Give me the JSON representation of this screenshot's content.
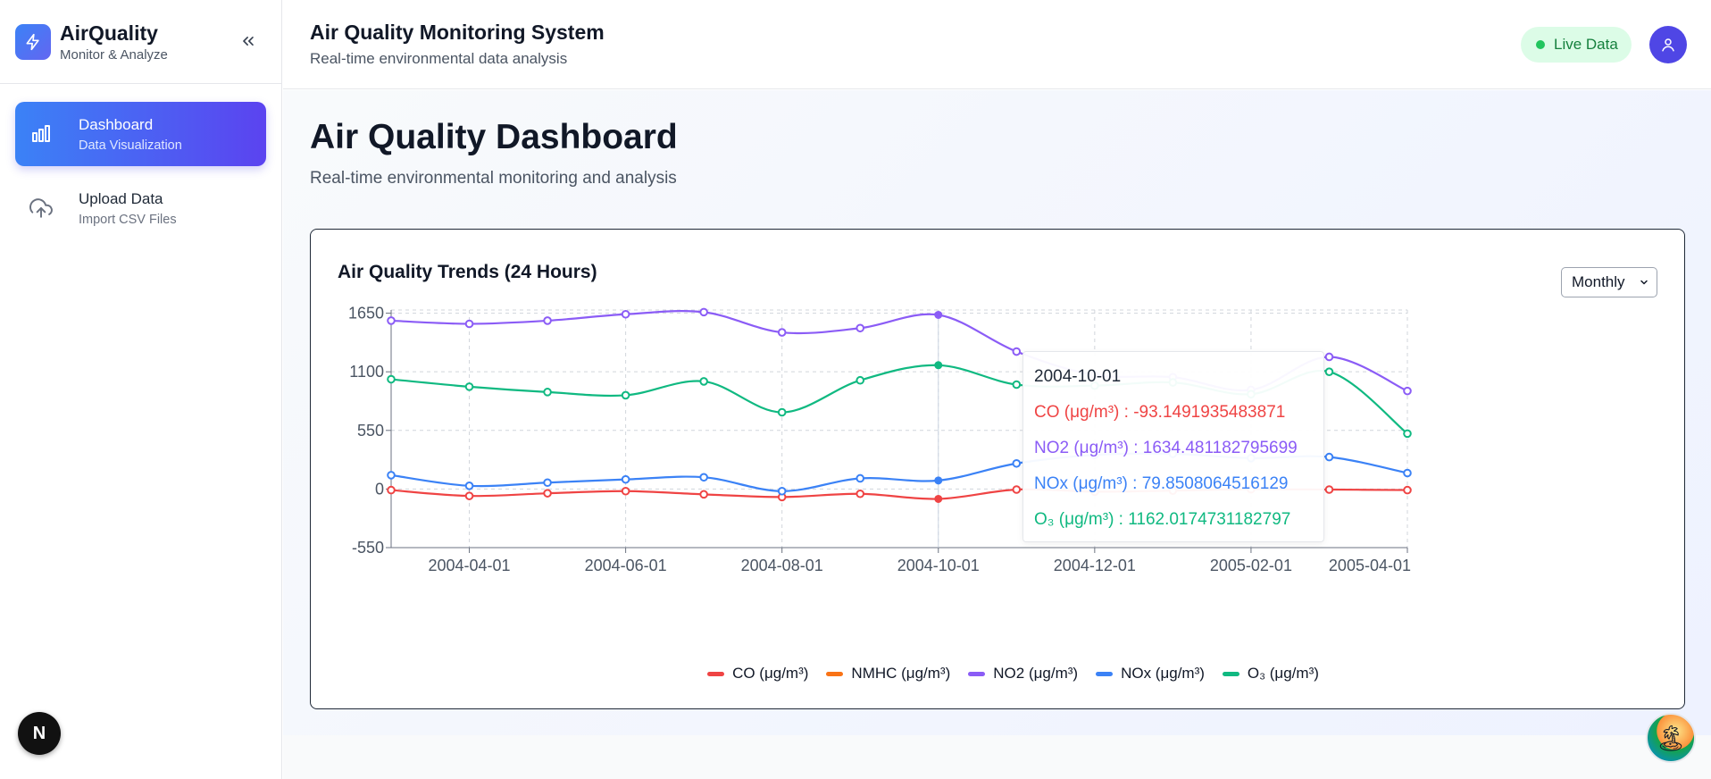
{
  "brand": {
    "title": "AirQuality",
    "subtitle": "Monitor & Analyze"
  },
  "nav": [
    {
      "label": "Dashboard",
      "sub": "Data Visualization",
      "icon": "bar-chart-icon",
      "active": true
    },
    {
      "label": "Upload Data",
      "sub": "Import CSV Files",
      "icon": "cloud-upload-icon",
      "active": false
    }
  ],
  "header": {
    "title": "Air Quality Monitoring System",
    "subtitle": "Real-time environmental data analysis",
    "live_label": "Live Data"
  },
  "page": {
    "title": "Air Quality Dashboard",
    "subtitle": "Real-time environmental monitoring and analysis"
  },
  "card": {
    "title": "Air Quality Trends (24 Hours)",
    "period": "Monthly",
    "period_options": [
      "Monthly"
    ]
  },
  "tooltip": {
    "date": "2004-10-01",
    "rows": [
      {
        "label": "CO (μg/m³) : -93.1491935483871",
        "color": "#ef4444"
      },
      {
        "label": "NO2 (μg/m³) : 1634.481182795699",
        "color": "#8b5cf6"
      },
      {
        "label": "NOx (μg/m³) : 79.8508064516129",
        "color": "#3b82f6"
      },
      {
        "label": "O₃ (μg/m³) : 1162.0174731182797",
        "color": "#10b981"
      }
    ]
  },
  "badge_letter": "N",
  "chart_data": {
    "type": "line",
    "x": [
      "2004-03-01",
      "2004-04-01",
      "2004-05-01",
      "2004-06-01",
      "2004-07-01",
      "2004-08-01",
      "2004-09-01",
      "2004-10-01",
      "2004-11-01",
      "2004-12-01",
      "2005-01-01",
      "2005-02-01",
      "2005-03-01",
      "2005-04-01"
    ],
    "xticks": [
      "2004-04-01",
      "2004-06-01",
      "2004-08-01",
      "2004-10-01",
      "2004-12-01",
      "2005-02-01",
      "2005-04-01"
    ],
    "yticks": [
      1650,
      1100,
      550,
      0,
      -550
    ],
    "ylim": [
      -550,
      1680
    ],
    "grid": true,
    "legend_position": "bottom",
    "highlight_x": "2004-10-01",
    "series": [
      {
        "name": "CO (μg/m³)",
        "color": "#ef4444",
        "values": [
          -10,
          -65,
          -40,
          -20,
          -50,
          -75,
          -45,
          -93,
          -5,
          -25,
          -15,
          -2,
          -5,
          -10
        ]
      },
      {
        "name": "NMHC (μg/m³)",
        "color": "#f97316",
        "values": []
      },
      {
        "name": "NO2 (μg/m³)",
        "color": "#8b5cf6",
        "values": [
          1580,
          1550,
          1580,
          1640,
          1660,
          1470,
          1510,
          1634,
          1290,
          1070,
          1050,
          930,
          1240,
          920
        ]
      },
      {
        "name": "NOx (μg/m³)",
        "color": "#3b82f6",
        "values": [
          130,
          30,
          60,
          90,
          110,
          -20,
          100,
          80,
          240,
          320,
          330,
          290,
          300,
          150
        ]
      },
      {
        "name": "O₃ (μg/m³)",
        "color": "#10b981",
        "values": [
          1030,
          960,
          910,
          880,
          1010,
          720,
          1020,
          1162,
          980,
          970,
          1000,
          890,
          1100,
          520
        ]
      }
    ]
  }
}
